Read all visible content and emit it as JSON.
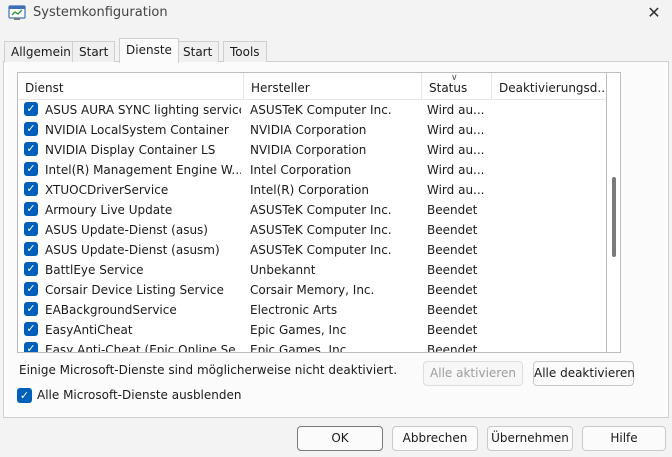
{
  "window": {
    "title": "Systemkonfiguration"
  },
  "tabs": [
    "Allgemein",
    "Start",
    "Dienste",
    "Start",
    "Tools"
  ],
  "table": {
    "headers": {
      "service": "Dienst",
      "vendor": "Hersteller",
      "status": "Status",
      "disabled": "Deaktivierungsd..."
    },
    "rows": [
      {
        "service": "ASUS AURA SYNC lighting service",
        "vendor": "ASUSTeK Computer Inc.",
        "status": "Wird au..."
      },
      {
        "service": "NVIDIA LocalSystem Container",
        "vendor": "NVIDIA Corporation",
        "status": "Wird au..."
      },
      {
        "service": "NVIDIA Display Container LS",
        "vendor": "NVIDIA Corporation",
        "status": "Wird au..."
      },
      {
        "service": "Intel(R) Management Engine W...",
        "vendor": "Intel Corporation",
        "status": "Wird au..."
      },
      {
        "service": "XTUOCDriverService",
        "vendor": "Intel(R) Corporation",
        "status": "Wird au..."
      },
      {
        "service": "Armoury Live Update",
        "vendor": "ASUSTeK Computer Inc.",
        "status": "Beendet"
      },
      {
        "service": "ASUS Update-Dienst (asus)",
        "vendor": "ASUSTeK Computer Inc.",
        "status": "Beendet"
      },
      {
        "service": "ASUS Update-Dienst (asusm)",
        "vendor": "ASUSTeK Computer Inc.",
        "status": "Beendet"
      },
      {
        "service": "BattlEye Service",
        "vendor": "Unbekannt",
        "status": "Beendet"
      },
      {
        "service": "Corsair Device Listing Service",
        "vendor": "Corsair Memory, Inc.",
        "status": "Beendet"
      },
      {
        "service": "EABackgroundService",
        "vendor": "Electronic Arts",
        "status": "Beendet"
      },
      {
        "service": "EasyAntiCheat",
        "vendor": "Epic Games, Inc",
        "status": "Beendet"
      },
      {
        "service": "Easy Anti-Cheat (Epic Online Se...",
        "vendor": "Epic Games, Inc",
        "status": "Beendet"
      }
    ]
  },
  "note": "Einige Microsoft-Dienste sind möglicherweise nicht deaktiviert.",
  "buttons": {
    "enable_all": "Alle aktivieren",
    "disable_all": "Alle deaktivieren",
    "ok": "OK",
    "cancel": "Abbrechen",
    "apply": "Übernehmen",
    "help": "Hilfe"
  },
  "hide_ms": {
    "label": "Alle Microsoft-Dienste ausblenden",
    "checked": true
  },
  "colors": {
    "accent": "#005fb8"
  },
  "icons": {
    "app": "msconfig-icon",
    "close": "close-icon",
    "check": "checkmark-icon",
    "sort": "sort-caret-icon"
  }
}
